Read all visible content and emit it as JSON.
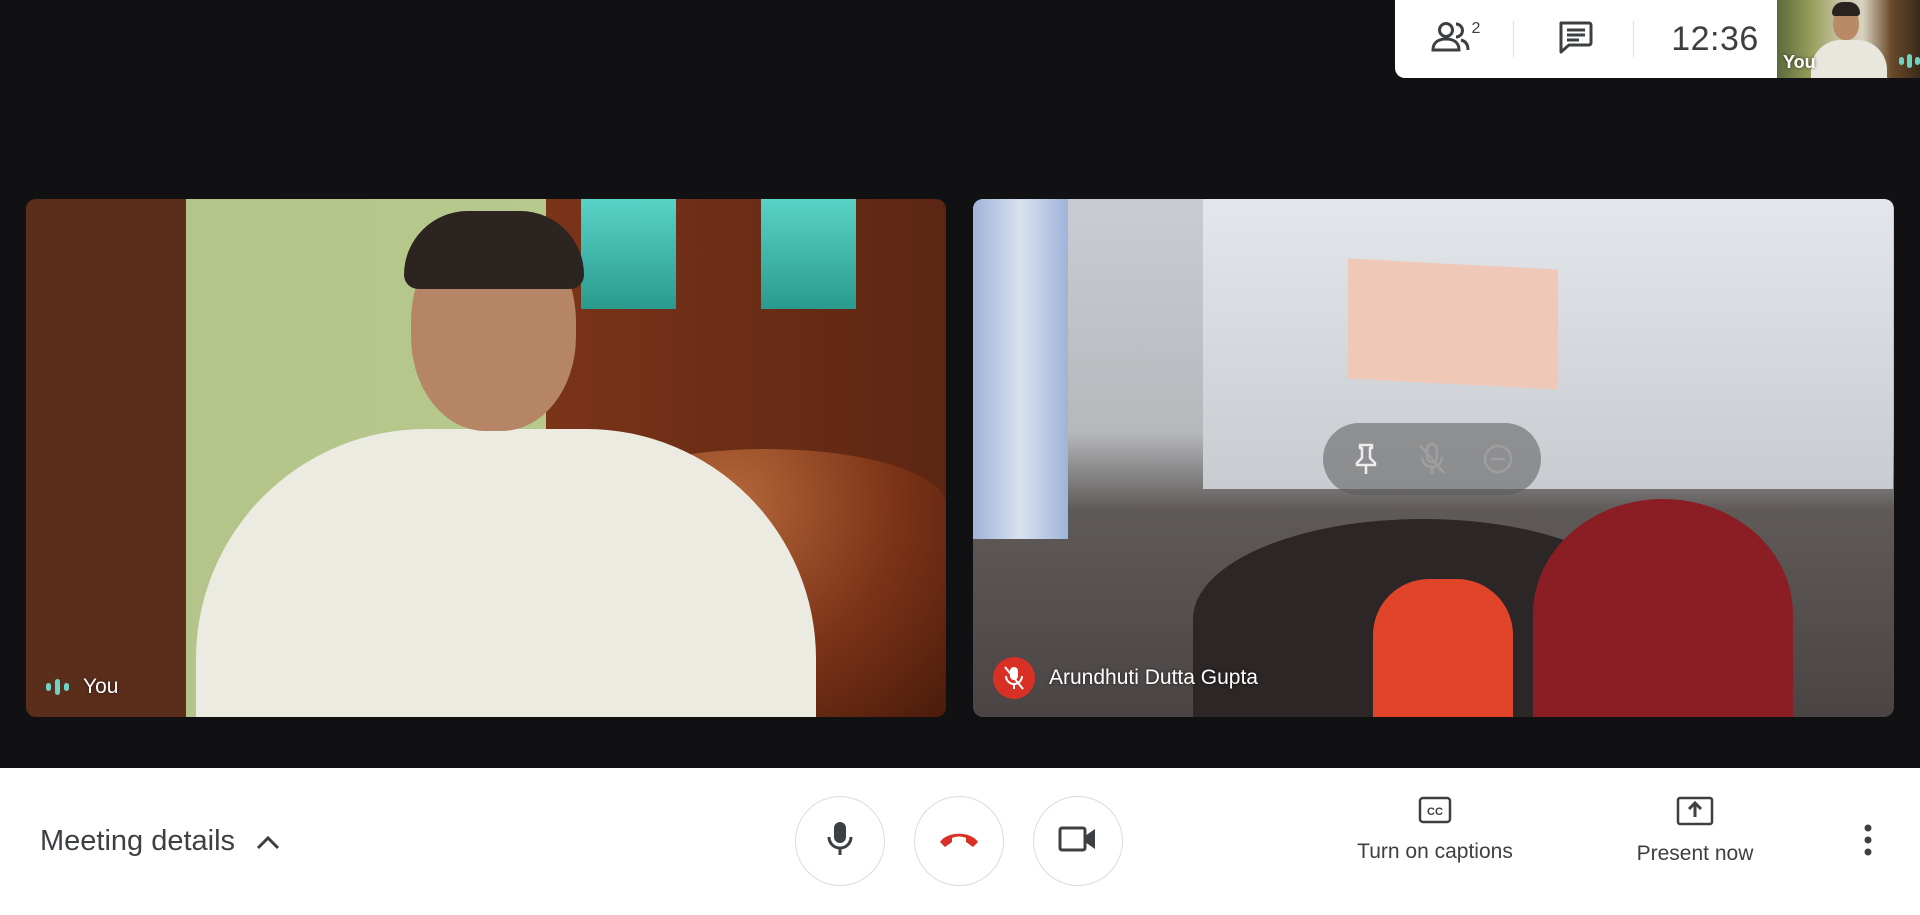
{
  "topbar": {
    "participants_count": "2",
    "clock": "12:36",
    "icons": {
      "people": "people-icon",
      "chat": "chat-icon"
    }
  },
  "self_view": {
    "label": "You"
  },
  "tiles": [
    {
      "name": "You",
      "muted": false,
      "speaking": true
    },
    {
      "name": "Arundhuti Dutta Gupta",
      "muted": true,
      "speaking": false
    }
  ],
  "tile_hover_controls": [
    "pin-icon",
    "mic-off-icon",
    "remove-icon"
  ],
  "bottombar": {
    "meeting_details_label": "Meeting details",
    "captions_label": "Turn on captions",
    "present_label": "Present now",
    "icons": [
      "chevron-up-icon",
      "mic-icon",
      "hangup-icon",
      "camera-icon",
      "captions-icon",
      "present-icon",
      "more-vert-icon"
    ]
  },
  "colors": {
    "background": "#111113",
    "panel": "#ffffff",
    "hangup_red": "#d93025",
    "speaking_teal": "#6cd3c5",
    "text_dark": "#3c4043"
  }
}
